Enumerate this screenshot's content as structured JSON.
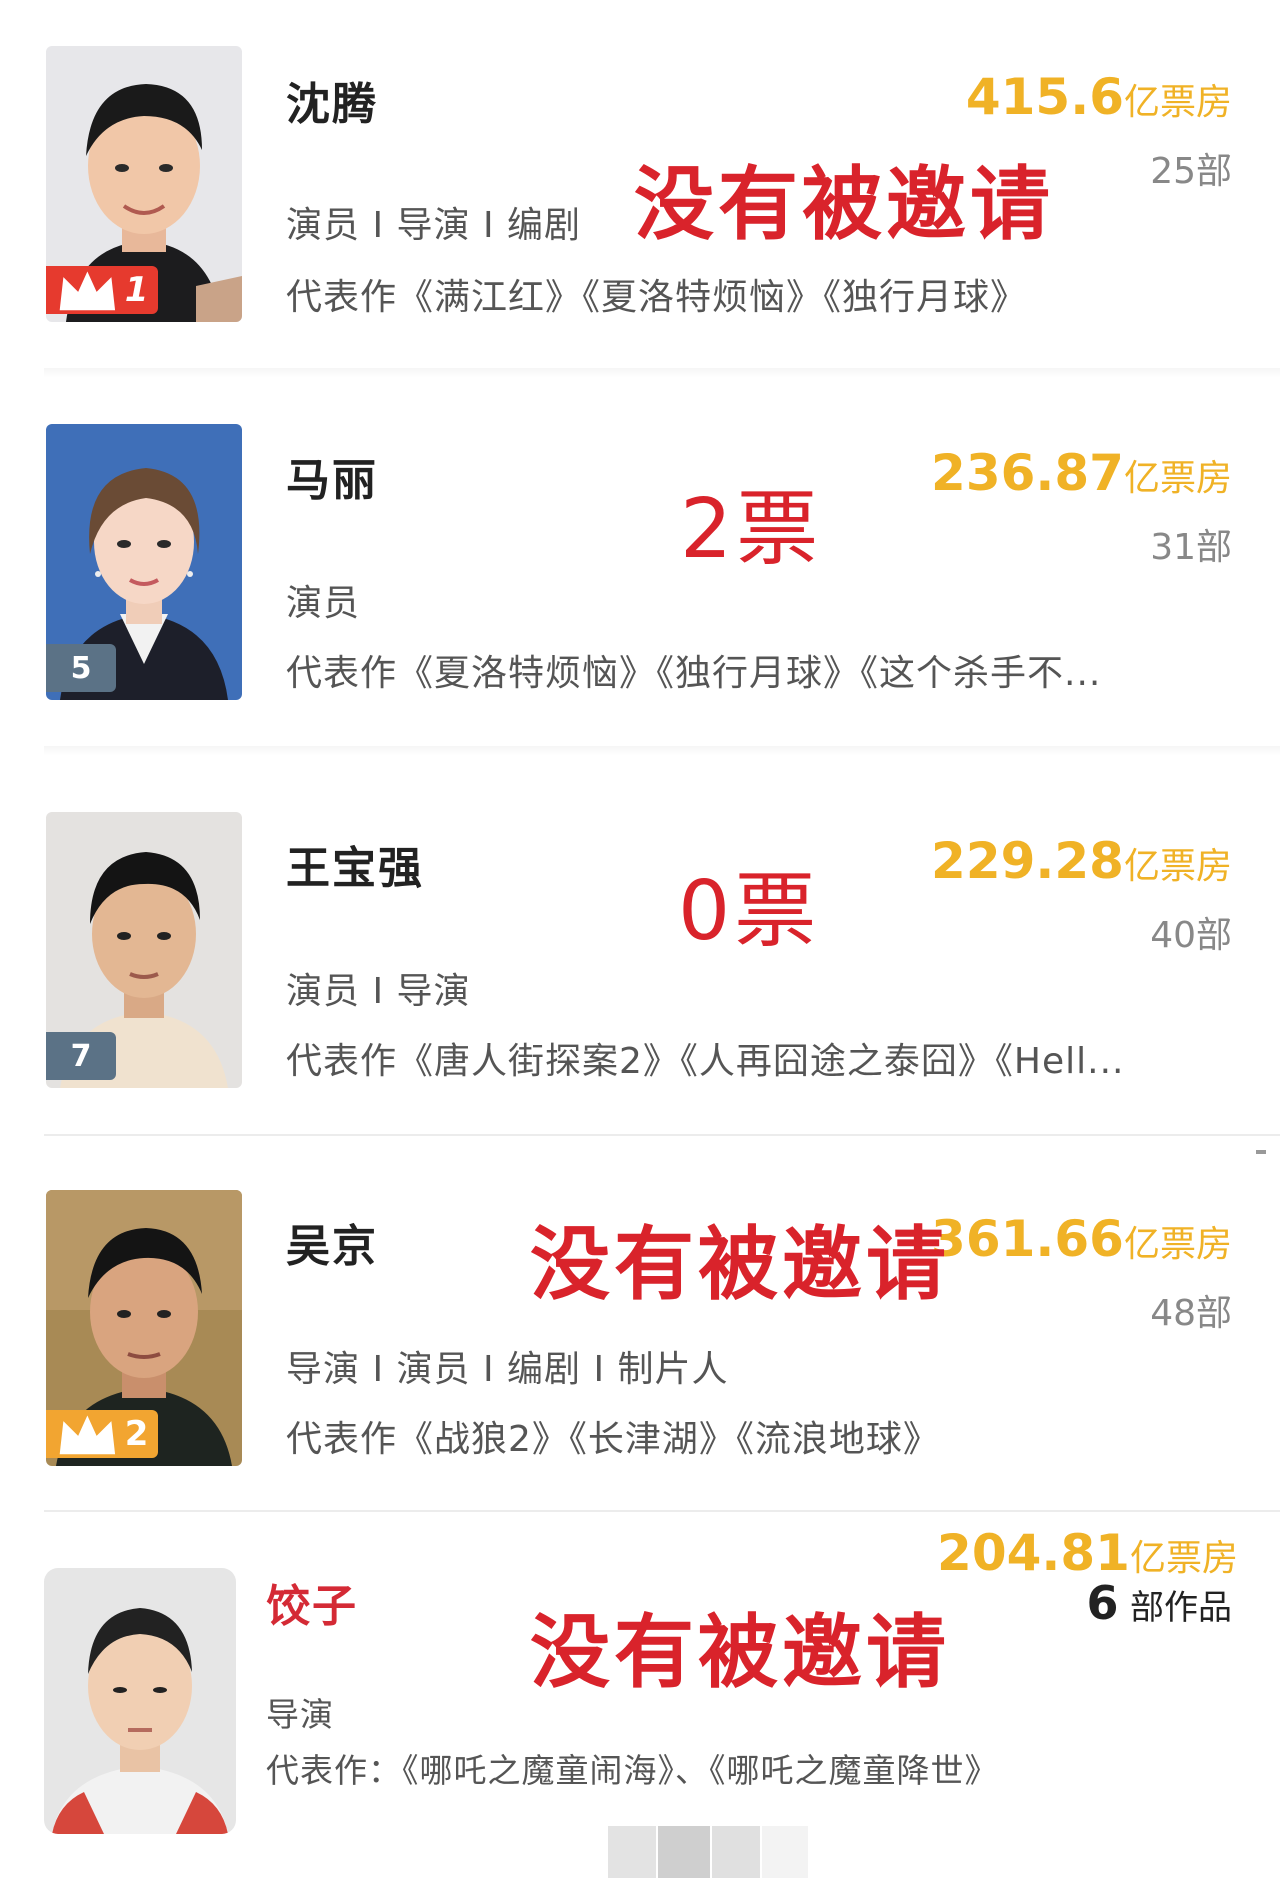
{
  "entries": [
    {
      "name": "沈腾",
      "rank": "1",
      "rank_style": "crown-red",
      "roles": "演员 I 导演 I 编剧",
      "works": "代表作《满江红》《夏洛特烦恼》《独行月球》",
      "box_office_value": "415.6",
      "box_office_unit": "亿票房",
      "film_count": "25部",
      "overlay": "没有被邀请"
    },
    {
      "name": "马丽",
      "rank": "5",
      "rank_style": "plain",
      "roles": "演员",
      "works": "代表作《夏洛特烦恼》《独行月球》《这个杀手不...",
      "box_office_value": "236.87",
      "box_office_unit": "亿票房",
      "film_count": "31部",
      "overlay": "2票"
    },
    {
      "name": "王宝强",
      "rank": "7",
      "rank_style": "plain",
      "roles": "演员 I 导演",
      "works": "代表作《唐人街探案2》《人再囧途之泰囧》《Hell...",
      "box_office_value": "229.28",
      "box_office_unit": "亿票房",
      "film_count": "40部",
      "overlay": "0票"
    },
    {
      "name": "吴京",
      "rank": "2",
      "rank_style": "crown-orange",
      "roles": "导演 I 演员 I 编剧 I 制片人",
      "works": "代表作《战狼2》《长津湖》《流浪地球》",
      "box_office_value": "361.66",
      "box_office_unit": "亿票房",
      "film_count": "48部",
      "overlay": "没有被邀请"
    },
    {
      "name": "饺子",
      "roles": "导演",
      "works": "代表作：《哪吒之魔童闹海》、《哪吒之魔童降世》",
      "box_office_value": "204.81",
      "box_office_unit": "亿票房",
      "film_count_number": "6",
      "film_count_unit": "部作品",
      "overlay": "没有被邀请"
    }
  ],
  "colors": {
    "box_office": "#f0b226",
    "overlay_red": "#d9232b",
    "rank_red": "#e63a2e",
    "rank_orange": "#f2a531",
    "rank_slate": "#5b7286"
  },
  "icons": [
    "crown-icon"
  ]
}
